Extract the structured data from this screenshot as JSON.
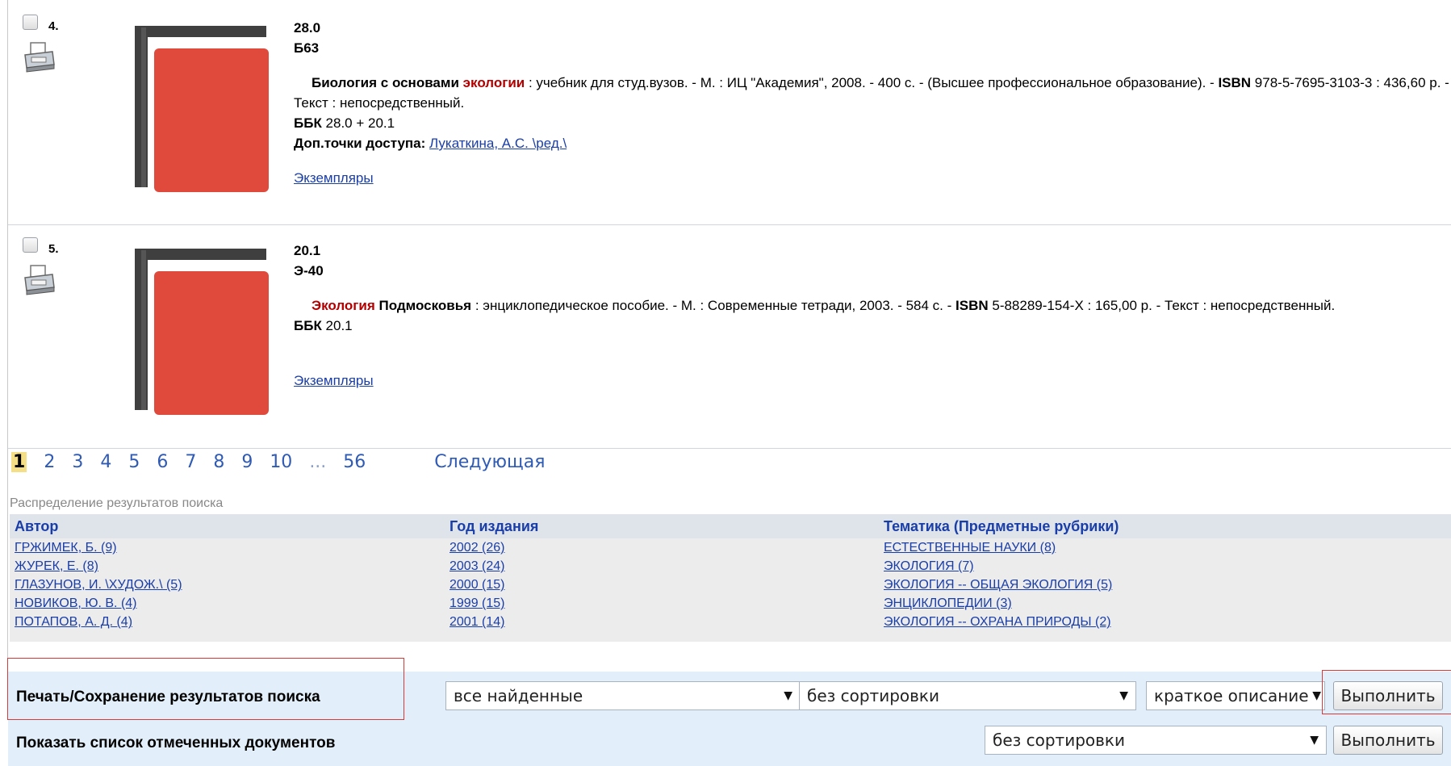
{
  "records": [
    {
      "number": "4.",
      "class_code": "28.0",
      "author_mark": "Б63",
      "title_pre": "Биология с основами ",
      "title_hl": "экологии",
      "desc_rest": " : учебник для студ.вузов. - М. : ИЦ \"Академия\", 2008. - 400 с. - (Высшее профессиональное образование). - ",
      "isbn_label": "ISBN",
      "isbn_rest": " 978-5-7695-3103-3 : 436,60 р. - Текст : непосредственный.",
      "bbk_label": "ББК",
      "bbk_value": " 28.0 + 20.1",
      "access_label": "Доп.точки доступа: ",
      "access_link": "Лукаткина, А.С. \\ред.\\",
      "copies_link": "Экземпляры"
    },
    {
      "number": "5.",
      "class_code": "20.1",
      "author_mark": "Э-40",
      "title_hl": "Экология",
      "title_post": " Подмосковья",
      "desc_rest": " : энциклопедическое пособие. - М. : Современные тетради, 2003. - 584 с. - ",
      "isbn_label": "ISBN",
      "isbn_rest": " 5-88289-154-X : 165,00 р. - Текст : непосредственный.",
      "bbk_label": "ББК",
      "bbk_value": " 20.1",
      "copies_link": "Экземпляры"
    }
  ],
  "pagination": {
    "current": "1",
    "pages": [
      "2",
      "3",
      "4",
      "5",
      "6",
      "7",
      "8",
      "9",
      "10"
    ],
    "ellipsis": "...",
    "last": "56",
    "next": "Следующая"
  },
  "distribution": {
    "title": "Распределение результатов поиска",
    "author": {
      "header": "Автор",
      "items": [
        "ГРЖИМЕК, Б. (9)",
        "ЖУРЕК, Е. (8)",
        "ГЛАЗУНОВ, И. \\ХУДОЖ.\\ (5)",
        "НОВИКОВ, Ю. В. (4)",
        "ПОТАПОВ, А. Д. (4)"
      ]
    },
    "year": {
      "header": "Год издания",
      "items": [
        "2002 (26)",
        "2003 (24)",
        "2000 (15)",
        "1999 (15)",
        "2001 (14)"
      ]
    },
    "subject": {
      "header": "Тематика (Предметные рубрики)",
      "items": [
        "ЕСТЕСТВЕННЫЕ НАУКИ (8)",
        "ЭКОЛОГИЯ (7)",
        "ЭКОЛОГИЯ -- ОБЩАЯ ЭКОЛОГИЯ (5)",
        "ЭНЦИКЛОПЕДИИ (3)",
        "ЭКОЛОГИЯ -- ОХРАНА ПРИРОДЫ (2)"
      ]
    }
  },
  "print_save": {
    "label": "Печать/Сохранение результатов поиска",
    "scope": "все найденные",
    "sort": "без сортировки",
    "format": "краткое описание",
    "execute": "Выполнить"
  },
  "marked_docs": {
    "label": "Показать список отмеченных документов",
    "sort": "без сортировки",
    "execute": "Выполнить"
  },
  "colors": {
    "link": "#1a3ea8",
    "highlight": "#b40000",
    "book_red": "#df4a3c",
    "book_dark": "#3f3f3f"
  }
}
